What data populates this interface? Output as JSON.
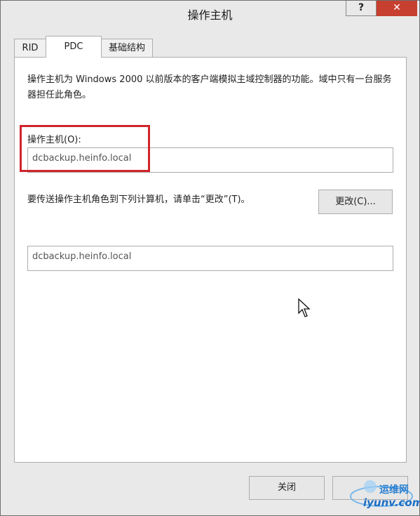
{
  "window": {
    "title": "操作主机",
    "help_label": "?",
    "close_label": "✕"
  },
  "tabs": [
    {
      "label": "RID",
      "active": false
    },
    {
      "label": "PDC",
      "active": true
    },
    {
      "label": "基础结构",
      "active": false
    }
  ],
  "pdc": {
    "description": "操作主机为 Windows 2000 以前版本的客户端模拟主域控制器的功能。域中只有一台服务器担任此角色。",
    "operations_master_label": "操作主机(O):",
    "operations_master_value": "dcbackup.heinfo.local",
    "transfer_instruction": "要传送操作主机角色到下列计算机，请单击“更改”(T)。",
    "change_button": "更改(C)...",
    "target_computer_value": "dcbackup.heinfo.local"
  },
  "footer": {
    "close_button": "关闭"
  },
  "watermark": {
    "line1": "运维网",
    "line2": "iyunv.com"
  },
  "colors": {
    "highlight": "#d0242c",
    "close_button_bg": "#c7402f"
  }
}
